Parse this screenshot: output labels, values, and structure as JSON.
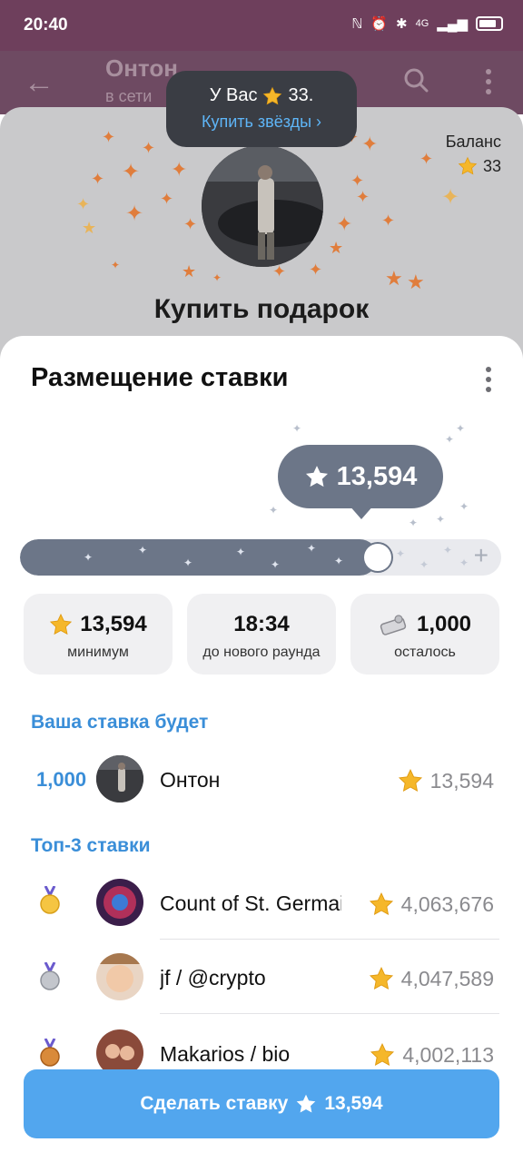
{
  "status_bar": {
    "time": "20:40",
    "network": "4G"
  },
  "chat_header": {
    "title": "Онтон",
    "subtitle": "в сети"
  },
  "gift_sheet": {
    "balance_label": "Баланс",
    "balance_value": "33",
    "title": "Купить подарок"
  },
  "stars_tooltip": {
    "prefix": "У Вас",
    "amount": "33.",
    "link": "Купить звёзды ›"
  },
  "bid_sheet": {
    "title": "Размещение ставки",
    "bid_amount": "13,594",
    "slider_fraction": 0.71,
    "stats": [
      {
        "value": "13,594",
        "label": "минимум",
        "icon": "star-icon"
      },
      {
        "value": "18:34",
        "label": "до нового раунда",
        "icon": ""
      },
      {
        "value": "1,000",
        "label": "осталось",
        "icon": "gift-icon"
      }
    ],
    "your_bid_header": "Ваша ставка будет",
    "your_bid": {
      "rank": "1,000",
      "name": "Онтон",
      "amount": "13,594"
    },
    "top_header": "Топ-3 ставки",
    "top_bids": [
      {
        "name": "Count of St. Germain",
        "amount": "4,063,676",
        "medal": "gold-medal-icon"
      },
      {
        "name": "jf / @crypto",
        "amount": "4,047,589",
        "medal": "silver-medal-icon"
      },
      {
        "name": "Makarios / bio",
        "amount": "4,002,113",
        "medal": "bronze-medal-icon"
      }
    ],
    "action_button": {
      "label": "Сделать ставку",
      "amount": "13,594"
    }
  },
  "colors": {
    "accent": "#52a6ee",
    "link_blue": "#3a8ed8",
    "slider": "#6c7688",
    "star": "#f5b72a"
  }
}
